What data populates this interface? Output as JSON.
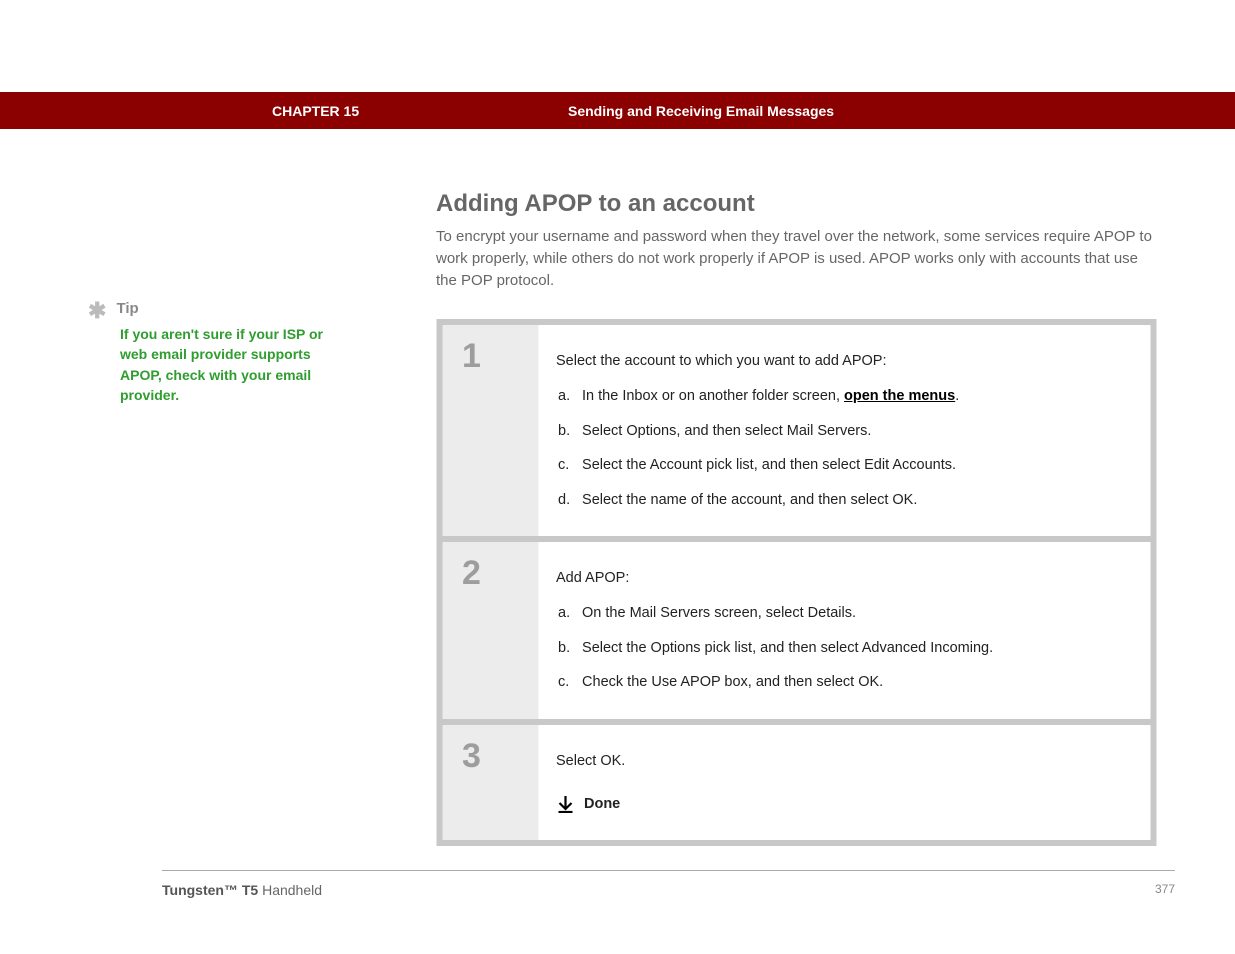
{
  "chapter": {
    "label": "CHAPTER 15",
    "title": "Sending and Receiving Email Messages"
  },
  "tip": {
    "label": "Tip",
    "body": "If you aren't sure if your ISP or web email provider supports APOP, check with your email provider."
  },
  "section": {
    "title": "Adding APOP to an account",
    "body": "To encrypt your username and password when they travel over the network, some services require APOP to work properly, while others do not work properly if APOP is used. APOP works only with accounts that use the POP protocol."
  },
  "steps": [
    {
      "num": "1",
      "intro": "Select the account to which you want to add APOP:",
      "subs": [
        {
          "letter": "a.",
          "prefix": "In the Inbox or on another folder screen, ",
          "link": "open the menus",
          "suffix": "."
        },
        {
          "letter": "b.",
          "prefix": "Select Options, and then select Mail Servers.",
          "link": "",
          "suffix": ""
        },
        {
          "letter": "c.",
          "prefix": "Select the Account pick list, and then select Edit Accounts.",
          "link": "",
          "suffix": ""
        },
        {
          "letter": "d.",
          "prefix": "Select the name of the account, and then select OK.",
          "link": "",
          "suffix": ""
        }
      ]
    },
    {
      "num": "2",
      "intro": "Add APOP:",
      "subs": [
        {
          "letter": "a.",
          "prefix": "On the Mail Servers screen, select Details.",
          "link": "",
          "suffix": ""
        },
        {
          "letter": "b.",
          "prefix": "Select the Options pick list, and then select Advanced Incoming.",
          "link": "",
          "suffix": ""
        },
        {
          "letter": "c.",
          "prefix": "Check the Use APOP box, and then select OK.",
          "link": "",
          "suffix": ""
        }
      ]
    },
    {
      "num": "3",
      "intro": "Select OK.",
      "done": "Done"
    }
  ],
  "footer": {
    "product_bold": "Tungsten™ T5",
    "product_rest": " Handheld",
    "page": "377"
  }
}
